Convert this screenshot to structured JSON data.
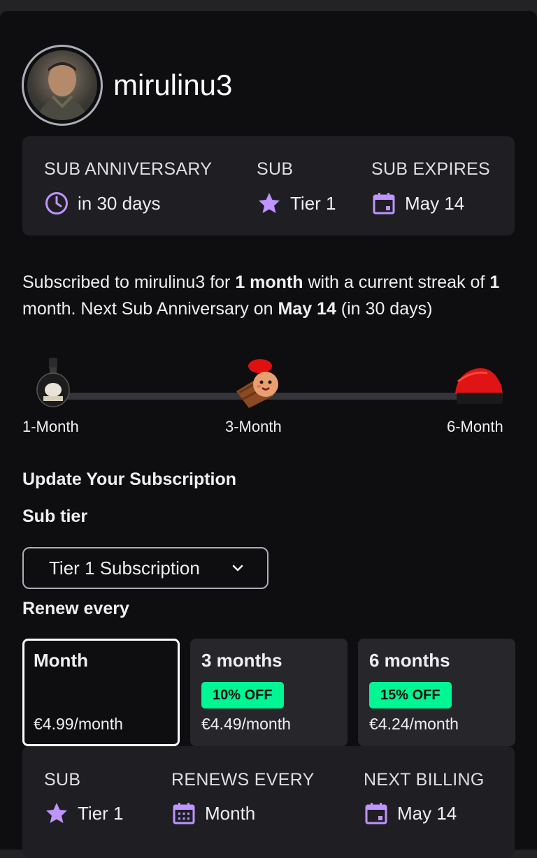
{
  "profile": {
    "username": "mirulinu3"
  },
  "sub_info": {
    "anniversary_label": "SUB ANNIVERSARY",
    "anniversary_value": "in 30 days",
    "sub_label": "SUB",
    "sub_value": "Tier 1",
    "expires_label": "SUB EXPIRES",
    "expires_value": "May 14"
  },
  "description": {
    "p1": "Subscribed to mirulinu3 for ",
    "b1": "1 month",
    "p2": " with a current streak of ",
    "b2": "1",
    "p3": " month. Next Sub Anniversary on ",
    "b3": "May 14",
    "p4": " (in 30 days)"
  },
  "milestones": [
    {
      "label": "1-Month",
      "icon": "bottle-badge-icon"
    },
    {
      "label": "3-Month",
      "icon": "log-character-badge-icon"
    },
    {
      "label": "6-Month",
      "icon": "red-hat-badge-icon"
    }
  ],
  "update": {
    "heading": "Update Your Subscription",
    "tier_heading": "Sub tier",
    "tier_selected": "Tier 1 Subscription",
    "renew_heading": "Renew every",
    "options": [
      {
        "title": "Month",
        "badge": "",
        "price": "€4.99/month",
        "selected": true
      },
      {
        "title": "3 months",
        "badge": "10% OFF",
        "price": "€4.49/month",
        "selected": false
      },
      {
        "title": "6 months",
        "badge": "15% OFF",
        "price": "€4.24/month",
        "selected": false
      }
    ]
  },
  "summary": {
    "sub_label": "SUB",
    "sub_value": "Tier 1",
    "renews_label": "RENEWS EVERY",
    "renews_value": "Month",
    "billing_label": "NEXT BILLING",
    "billing_value": "May 14"
  },
  "colors": {
    "accent_purple": "#bf94ff",
    "discount_green": "#00f593",
    "background": "#0e0e10",
    "card": "#1f1f23"
  }
}
